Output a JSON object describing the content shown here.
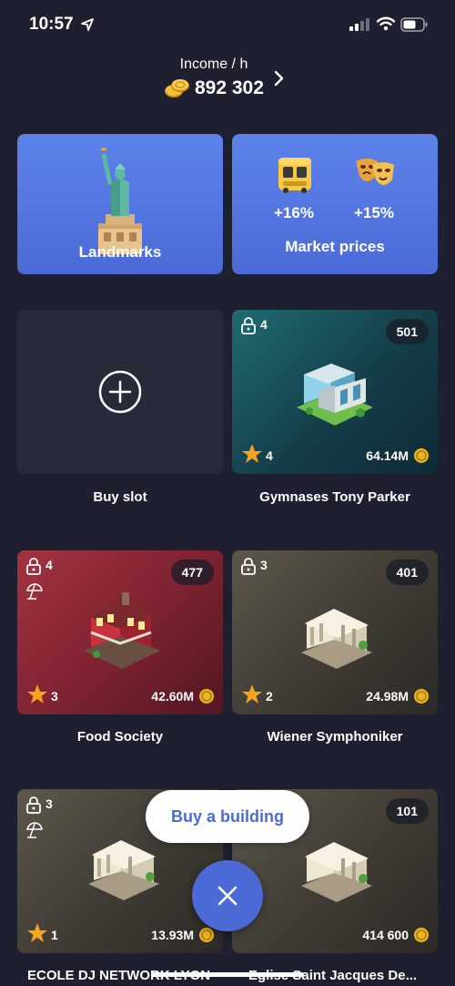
{
  "status": {
    "time": "10:57"
  },
  "income": {
    "label": "Income / h",
    "value": "892 302"
  },
  "top_cards": {
    "landmarks_label": "Landmarks",
    "market_label": "Market prices",
    "market_bonus_1": "+16%",
    "market_bonus_2": "+15%"
  },
  "slots": [
    {
      "caption": "Buy slot"
    },
    {
      "caption": "Gymnases Tony Parker",
      "badge": "501",
      "lock": "4",
      "stars": "4",
      "price": "64.14M"
    },
    {
      "caption": "Food Society",
      "badge": "477",
      "lock": "4",
      "stars": "3",
      "price": "42.60M"
    },
    {
      "caption": "Wiener Symphoniker",
      "badge": "401",
      "lock": "3",
      "stars": "2",
      "price": "24.98M"
    },
    {
      "caption": "ECOLE DJ NETWORK LYON",
      "lock": "3",
      "stars": "1",
      "price": "13.93M"
    },
    {
      "caption": "Eglise Saint Jacques De...",
      "badge": "101",
      "price": "414 600"
    }
  ],
  "actions": {
    "buy_building": "Buy a building"
  },
  "colors": {
    "accent": "#4c6ad6",
    "background": "#1e2030",
    "star": "#f6a323",
    "coin": "#e8b525"
  }
}
